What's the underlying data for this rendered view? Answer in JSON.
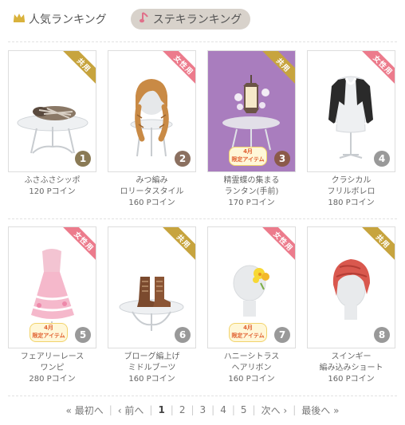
{
  "tabs": {
    "ranking_label": "人気ランキング",
    "suteki_label": "ステキランキング"
  },
  "items": [
    {
      "name_line1": "ふさふさシッポ",
      "name_line2": "",
      "price": "120 Pコイン",
      "tag": "共用",
      "rank": "1",
      "limited": ""
    },
    {
      "name_line1": "みつ編み",
      "name_line2": "ロリータスタイル",
      "price": "160 Pコイン",
      "tag": "女性用",
      "rank": "2",
      "limited": ""
    },
    {
      "name_line1": "精霊蝶の集まる",
      "name_line2": "ランタン(手前)",
      "price": "170 Pコイン",
      "tag": "共用",
      "rank": "3",
      "limited": "4月\n限定アイテム"
    },
    {
      "name_line1": "クラシカル",
      "name_line2": "フリルボレロ",
      "price": "180 Pコイン",
      "tag": "女性用",
      "rank": "4",
      "limited": ""
    },
    {
      "name_line1": "フェアリーレース",
      "name_line2": "ワンピ",
      "price": "280 Pコイン",
      "tag": "女性用",
      "rank": "5",
      "limited": "4月\n限定アイテム"
    },
    {
      "name_line1": "ブローグ編上げ",
      "name_line2": "ミドルブーツ",
      "price": "160 Pコイン",
      "tag": "共用",
      "rank": "6",
      "limited": ""
    },
    {
      "name_line1": "ハニーシトラス",
      "name_line2": "ヘアリボン",
      "price": "160 Pコイン",
      "tag": "女性用",
      "rank": "7",
      "limited": "4月\n限定アイテム"
    },
    {
      "name_line1": "スインギー",
      "name_line2": "編み込みショート",
      "price": "160 Pコイン",
      "tag": "共用",
      "rank": "8",
      "limited": ""
    }
  ],
  "pagination": {
    "first": "« 最初へ",
    "prev": "‹ 前へ",
    "pages": [
      "1",
      "2",
      "3",
      "4",
      "5"
    ],
    "current": "1",
    "next": "次へ ›",
    "last": "最後へ »"
  },
  "colors": {
    "tag_shared": "#c7a43e",
    "tag_female": "#ec7b8c",
    "rank_1": "#8a7a55",
    "rank_2": "#8b7060",
    "rank_3": "#8b5a4a",
    "rank_other": "#999999"
  }
}
